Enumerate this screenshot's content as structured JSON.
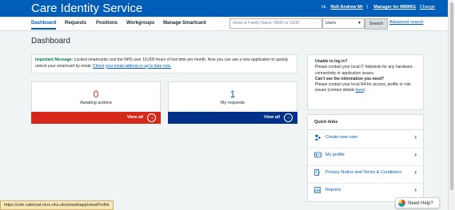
{
  "header": {
    "app_title": "Care Identity Service",
    "greeting": "Hi,",
    "user_name": "Nolt Andrew Mr",
    "role_link": "Manager for M89001",
    "change_link": "Change",
    "separator": "|"
  },
  "nav": {
    "items": [
      {
        "label": "Dashboard",
        "active": true
      },
      {
        "label": "Requests"
      },
      {
        "label": "Positions"
      },
      {
        "label": "Workgroups"
      },
      {
        "label": "Manage Smartcard"
      }
    ],
    "search_placeholder": "Given & Family Name, NINO or UUID",
    "search_type": "Users",
    "search_button": "Search",
    "advanced_search": "Advanced search"
  },
  "main": {
    "page_title": "Dashboard",
    "message": {
      "label": "Important Message:",
      "text": " Locked smartcards cost the NHS over 16,000 hours of lost time per month. Now you can use a new application to quickly unlock your smartcard by email. ",
      "link": "Check your email address is up to date now."
    },
    "cards": [
      {
        "count": "0",
        "label": "Awaiting actions",
        "button": "View all"
      },
      {
        "count": "1",
        "label": "My requests",
        "button": "View all"
      }
    ]
  },
  "sidebar": {
    "login_heading": "Unable to log in?",
    "login_text": "Please contact your local IT helpdesk for any hardware, connectivity or application issues.",
    "info_heading": "Can't see the information you need?",
    "info_text": "Please contact your local RA for access, profile or role issues (contact details ",
    "info_link": "here",
    "info_end": ").",
    "quick_links_title": "Quick links",
    "quick_links": [
      {
        "label": "Create new user",
        "icon": "add-user-icon"
      },
      {
        "label": "My profile",
        "icon": "id-card-icon"
      },
      {
        "label": "Privacy Notice and Terms & Conditions",
        "icon": "document-edit-icon"
      },
      {
        "label": "Reports",
        "icon": "report-icon"
      }
    ]
  },
  "status_bar": {
    "url": "https://uim.national.ncrs.nhs.uk/uiswebapp/viewProfile"
  },
  "help_widget": {
    "label": "Need Help?"
  },
  "colors": {
    "brand": "#005eb8",
    "alert": "#d5281b",
    "dark_blue": "#003087",
    "success": "#007f3b"
  }
}
